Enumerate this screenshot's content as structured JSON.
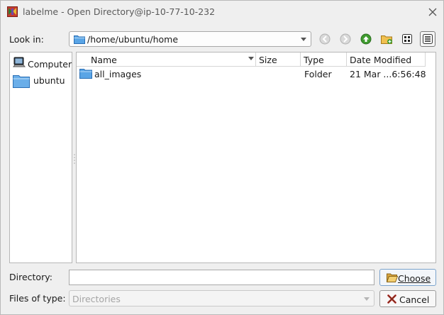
{
  "window": {
    "title": "labelme - Open Directory@ip-10-77-10-232"
  },
  "lookin": {
    "label": "Look in:",
    "path": "/home/ubuntu/home"
  },
  "toolbar": {
    "buttons": [
      "back",
      "forward",
      "parent-directory",
      "new-folder",
      "icon-view",
      "detail-view"
    ],
    "active": "detail-view"
  },
  "sidebar": {
    "items": [
      {
        "label": "Computer"
      },
      {
        "label": "ubuntu"
      }
    ]
  },
  "filelist": {
    "columns": [
      "Name",
      "Size",
      "Type",
      "Date Modified"
    ],
    "rows": [
      {
        "name": "all_images",
        "size": "",
        "type": "Folder",
        "date": "21 Mar ...6:56:48"
      }
    ]
  },
  "directory": {
    "label": "Directory:",
    "value": "",
    "choose_label": "Choose"
  },
  "filetypes": {
    "label": "Files of type:",
    "value": "Directories",
    "cancel_label": "Cancel"
  },
  "colors": {
    "background": "#efefef",
    "choose_border": "#7ba3cc",
    "up_arrow": "#3f9b2f",
    "folder": "#3c8fd8"
  }
}
